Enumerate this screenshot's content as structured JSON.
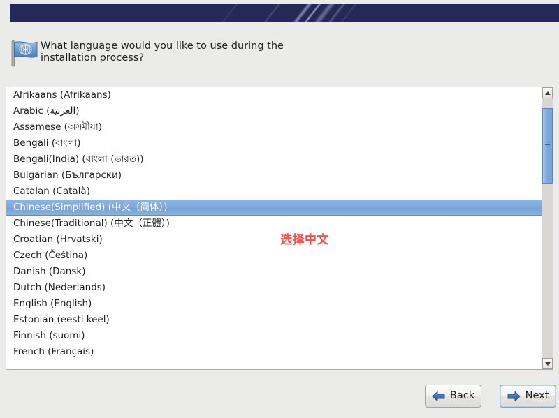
{
  "window": {
    "banner_color": "#232a56",
    "background_color": "#ebebe9"
  },
  "header": {
    "icon": "un-flag-icon",
    "question": "What language would you like to use during the installation process?"
  },
  "language_list": {
    "selected_index": 7,
    "items": [
      {
        "label": "Afrikaans (Afrikaans)"
      },
      {
        "label": "Arabic (العربية)"
      },
      {
        "label": "Assamese (অসমীয়া)"
      },
      {
        "label": "Bengali (বাংলা)"
      },
      {
        "label": "Bengali(India) (বাংলা (ভারত))"
      },
      {
        "label": "Bulgarian (Български)"
      },
      {
        "label": "Catalan (Català)"
      },
      {
        "label": "Chinese(Simplified) (中文（简体）)"
      },
      {
        "label": "Chinese(Traditional) (中文（正體）)"
      },
      {
        "label": "Croatian (Hrvatski)"
      },
      {
        "label": "Czech (Čeština)"
      },
      {
        "label": "Danish (Dansk)"
      },
      {
        "label": "Dutch (Nederlands)"
      },
      {
        "label": "English (English)"
      },
      {
        "label": "Estonian (eesti keel)"
      },
      {
        "label": "Finnish (suomi)"
      },
      {
        "label": "French (Français)"
      }
    ]
  },
  "scrollbar": {
    "up_icon": "chevron-up-icon",
    "down_icon": "chevron-down-icon",
    "thumb_position_percent": 4,
    "thumb_size_percent": 29
  },
  "annotation": {
    "text": "选择中文",
    "color": "#f2524e"
  },
  "footer": {
    "back_label": "Back",
    "back_icon": "arrow-left-icon",
    "next_label": "Next",
    "next_icon": "arrow-right-icon",
    "accent_color": "#2f6bb5"
  }
}
